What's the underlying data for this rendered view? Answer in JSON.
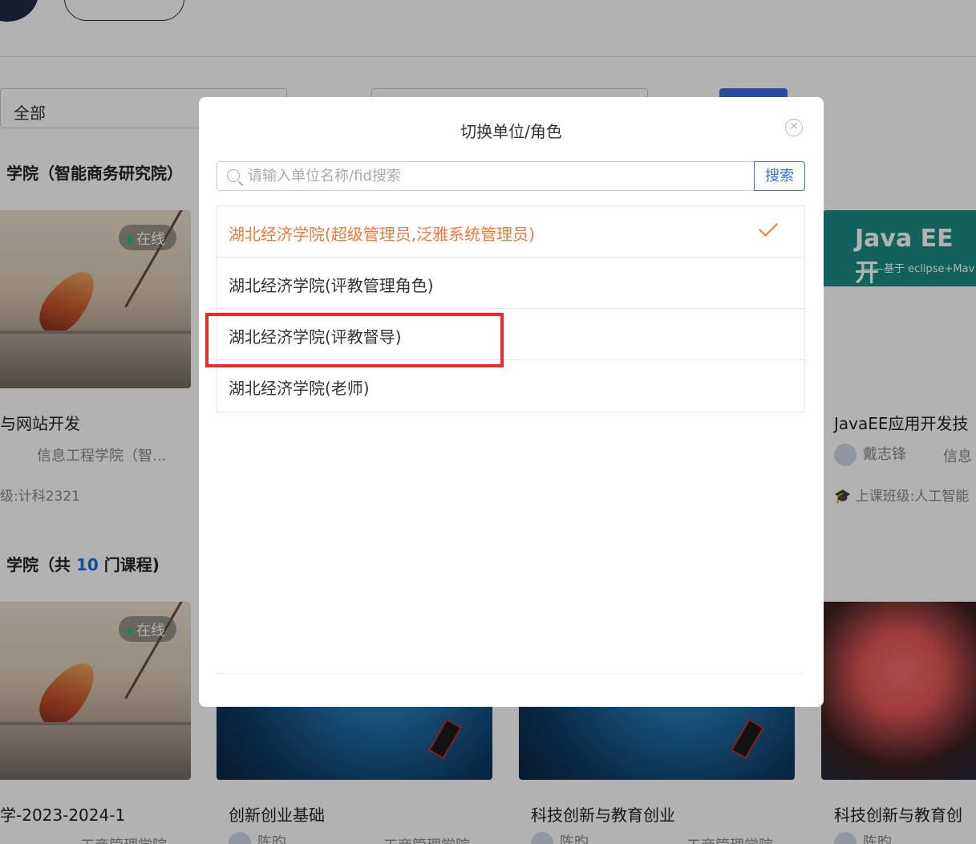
{
  "filters": {
    "category_value": "全部"
  },
  "sections": [
    {
      "title": "学院（智能商务研究院）"
    },
    {
      "title_prefix": "学院（共",
      "count": "10",
      "title_suffix": "门课程)"
    }
  ],
  "cards_row1": [
    {
      "badge": "在线",
      "title": "与网站开发",
      "college": "信息工程学院（智...",
      "class": "级:计科2321"
    },
    {
      "book_title": "Java EE 开",
      "book_subtitle": "——基于 eclipse+Mav",
      "title": "JavaEE应用开发技",
      "teacher": "戴志锋",
      "college": "信息",
      "class": "上课班级:人工智能"
    }
  ],
  "cards_row2": [
    {
      "badge": "在线",
      "title": "学-2023-2024-1",
      "college": "工商管理学院"
    },
    {
      "title": "创新创业基础",
      "teacher": "陈昀",
      "college": "工商管理学院"
    },
    {
      "title": "科技创新与教育创业",
      "teacher": "陈昀",
      "college": "工商管理学院"
    },
    {
      "title": "科技创新与教育创",
      "teacher": "陈昀"
    }
  ],
  "modal": {
    "title": "切换单位/角色",
    "close_icon": "close-circle-icon",
    "search_placeholder": "请输入单位名称/fid搜索",
    "search_button": "搜索",
    "roles": [
      {
        "label": "湖北经济学院(超级管理员,泛雅系统管理员)",
        "selected": true
      },
      {
        "label": "湖北经济学院(评教管理角色)",
        "selected": false
      },
      {
        "label": "湖北经济学院(评教督导)",
        "selected": false
      },
      {
        "label": "湖北经济学院(老师)",
        "selected": false
      }
    ]
  },
  "colors": {
    "accent": "#f07a3d",
    "primary": "#3a6ee8",
    "annotation": "#ee2b2b"
  }
}
